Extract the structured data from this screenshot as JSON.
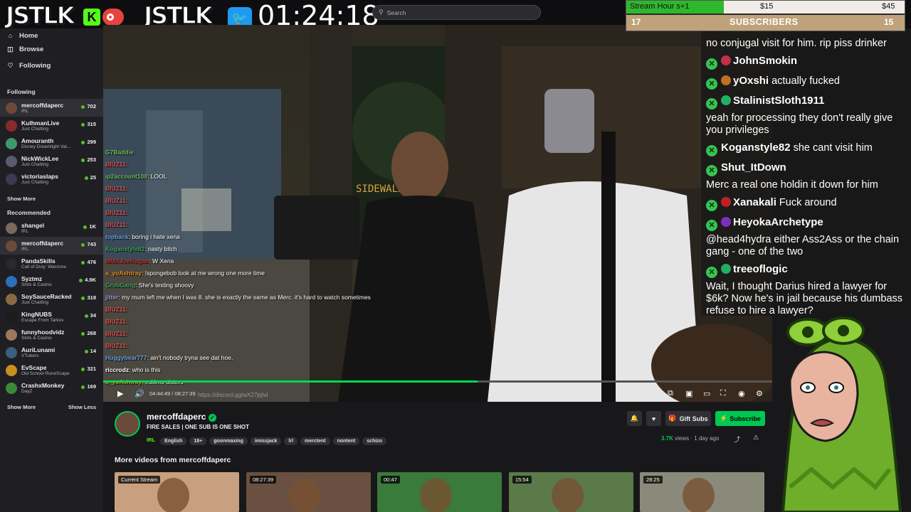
{
  "overlay": {
    "logo1": "JSTLK",
    "logo2": "JSTLK",
    "timer": "01:24:18"
  },
  "search": {
    "placeholder": "Search"
  },
  "nav": [
    {
      "label": "Home",
      "icon": "home-icon"
    },
    {
      "label": "Browse",
      "icon": "browse-icon"
    },
    {
      "label": "Following",
      "icon": "heart-icon"
    }
  ],
  "following": {
    "title": "Following",
    "channels": [
      {
        "name": "mercoffdaperc",
        "game": "IRL",
        "viewers": "702",
        "color": "#6b4a3a"
      },
      {
        "name": "KulhmanLive",
        "game": "Just Chatting",
        "viewers": "315",
        "color": "#8a2b2b"
      },
      {
        "name": "Amouranth",
        "game": "Disney Dreamlight Val...",
        "viewers": "299",
        "color": "#3f9a6a"
      },
      {
        "name": "NickWickLee",
        "game": "Just Chatting",
        "viewers": "253",
        "color": "#5a5a70"
      },
      {
        "name": "victoriaslaps",
        "game": "Just Chatting",
        "viewers": "25",
        "color": "#3a3a55"
      }
    ],
    "show_more": "Show More"
  },
  "recommended": {
    "title": "Recommended",
    "channels": [
      {
        "name": "shangel",
        "game": "IRL",
        "viewers": "1K",
        "color": "#7a6a5a"
      },
      {
        "name": "mercoffdaperc",
        "game": "IRL",
        "viewers": "743",
        "color": "#6b4a3a"
      },
      {
        "name": "PandaSkills",
        "game": "Call of Duty: Warzone",
        "viewers": "476",
        "color": "#2a2a2a"
      },
      {
        "name": "Syztmz",
        "game": "Slots & Casino",
        "viewers": "4.9K",
        "color": "#2b6fb8"
      },
      {
        "name": "SoySauceRacked",
        "game": "Just Chatting",
        "viewers": "318",
        "color": "#8a6a40"
      },
      {
        "name": "KingNUBS",
        "game": "Escape From Tarkov",
        "viewers": "34",
        "color": "#1c1c1c"
      },
      {
        "name": "funnyhoodvidz",
        "game": "Slots & Casino",
        "viewers": "268",
        "color": "#9a7a5a"
      },
      {
        "name": "AuriLunami",
        "game": "VTubers",
        "viewers": "14",
        "color": "#3a6080"
      },
      {
        "name": "EvScape",
        "game": "Old School RuneScape",
        "viewers": "321",
        "color": "#c89020"
      },
      {
        "name": "CrashxMonkey",
        "game": "DayZ",
        "viewers": "169",
        "color": "#3a8a3a"
      }
    ],
    "show_more": "Show More",
    "show_less": "Show Less"
  },
  "stream_stats": {
    "hour_label": "Stream Hour s+1",
    "price1": "$15",
    "price2": "$45",
    "subs_left": "17",
    "subs_label": "SUBSCRIBERS",
    "subs_right": "15",
    "progress": 0.35
  },
  "chat": [
    {
      "user": "",
      "text": "no conjugal visit for him. rip piss drinker",
      "color": "#ffffff",
      "badge": ""
    },
    {
      "user": "JohnSmokin",
      "text": "",
      "color": "#ffffff",
      "badge": "#c0304a"
    },
    {
      "user": "yOxshi",
      "text": "actually fucked",
      "color": "#ffffff",
      "badge": "#c07020"
    },
    {
      "user": "StalinistSloth1911",
      "text": "",
      "color": "#ffffff",
      "badge": "#20b060"
    },
    {
      "user": "",
      "text": "yeah for processing they don't really give you privileges",
      "color": "#ffffff",
      "badge": ""
    },
    {
      "user": "Koganstyle82",
      "text": "she cant visit him",
      "color": "#ffffff",
      "badge": ""
    },
    {
      "user": "Shut_ItDown",
      "text": "",
      "color": "#ffffff",
      "badge": ""
    },
    {
      "user": "",
      "text": "Merc a real one holdin it down for him",
      "color": "#ffffff",
      "badge": ""
    },
    {
      "user": "Xanakali",
      "text": "Fuck around",
      "color": "#ffffff",
      "badge": "#c02020"
    },
    {
      "user": "HeyokaArchetype",
      "text": "",
      "color": "#ffffff",
      "badge": "#7a30c0"
    },
    {
      "user": "",
      "text": "@head4hydra either Ass2Ass or the chain gang - one of the two",
      "color": "#ffffff",
      "badge": ""
    },
    {
      "user": "treeoflogic",
      "text": "",
      "color": "#ffffff",
      "badge": "#20b060"
    },
    {
      "user": "",
      "text": "Wait, I thought Darius hired a lawyer for $6k? Now he's in jail because his dumbass refuse to hire a lawyer?",
      "color": "#ffffff",
      "badge": ""
    }
  ],
  "video_chat": [
    {
      "user": "G7Baddie",
      "text": "",
      "color": "#6bbf5a"
    },
    {
      "user": "BIUZ11:",
      "text": "",
      "color": "#e05050"
    },
    {
      "user": "ip2account108",
      "text": ": LOOL",
      "color": "#6bbf5a"
    },
    {
      "user": "BIUZ11:",
      "text": "",
      "color": "#e05050"
    },
    {
      "user": "BIUZ11:",
      "text": "",
      "color": "#e05050"
    },
    {
      "user": "BIUZ11:",
      "text": "",
      "color": "#e05050"
    },
    {
      "user": "BIUZ11:",
      "text": "",
      "color": "#e05050"
    },
    {
      "user": "topback",
      "text": ": boring i hate xena",
      "color": "#6ba0e0"
    },
    {
      "user": "Koganstyle82",
      "text": ": nasty bitch",
      "color": "#3fa05a"
    },
    {
      "user": "MMAJoeRogan",
      "text": ": W Xena",
      "color": "#c03030"
    },
    {
      "user": "a_yoAshtray",
      "text": ": !spongebob look at me wrong one more time",
      "color": "#e08a20"
    },
    {
      "user": "GrobGang",
      "text": ": She's texting shoovy",
      "color": "#3fa05a"
    },
    {
      "user": "jitter",
      "text": ": my mum left me when I was 8. she is exactly the same as Merc. it's hard to watch sometimes",
      "color": "#9a9ae0"
    },
    {
      "user": "BIUZ11:",
      "text": "",
      "color": "#e05050"
    },
    {
      "user": "BIUZ11:",
      "text": "",
      "color": "#e05050"
    },
    {
      "user": "BIUZ11:",
      "text": "",
      "color": "#e05050"
    },
    {
      "user": "BIUZ11:",
      "text": "",
      "color": "#e05050"
    },
    {
      "user": "Huggybear777",
      "text": ": ain't nobody tryna see dat hoe.",
      "color": "#6ba0e0"
    },
    {
      "user": "riccrodz",
      "text": ": who is this",
      "color": "#ffffff"
    },
    {
      "user": "a_yoAshtray",
      "text": ": eskimo sisters",
      "color": "#e08a20"
    }
  ],
  "player": {
    "time": "04:44:49 / 08:27:39",
    "link": "https://discord.gg/wX27jqhd",
    "progress": 0.56,
    "sign": "SIDEWALK"
  },
  "channel": {
    "name": "mercoffdaperc",
    "title": "FIRE SALES | ONE SUB IS ONE SHOT",
    "category": "IRL",
    "tags": [
      "English",
      "18+",
      "goonmaxing",
      "imissjack",
      "lrl",
      "merctent",
      "nontent",
      "schizo"
    ],
    "views": "3.7K",
    "views_label": "views",
    "ago": "1 day ago",
    "gift_label": "Gift Subs",
    "subscribe_label": "Subscribe"
  },
  "more_videos": {
    "title": "More videos from mercoffdaperc",
    "items": [
      {
        "badge": "Current Stream",
        "color": "#c8a080"
      },
      {
        "badge": "08:27:39",
        "color": "#6a5040"
      },
      {
        "badge": "00:47",
        "color": "#3a7a3a"
      },
      {
        "badge": "15:54",
        "color": "#5a7a4a"
      },
      {
        "badge": "28:25",
        "color": "#8a8a7a"
      }
    ]
  },
  "colors": {
    "accent": "#9147ff",
    "subscribe": "#00c853",
    "live": "#4fc42a",
    "chat_check": "#35c452"
  }
}
